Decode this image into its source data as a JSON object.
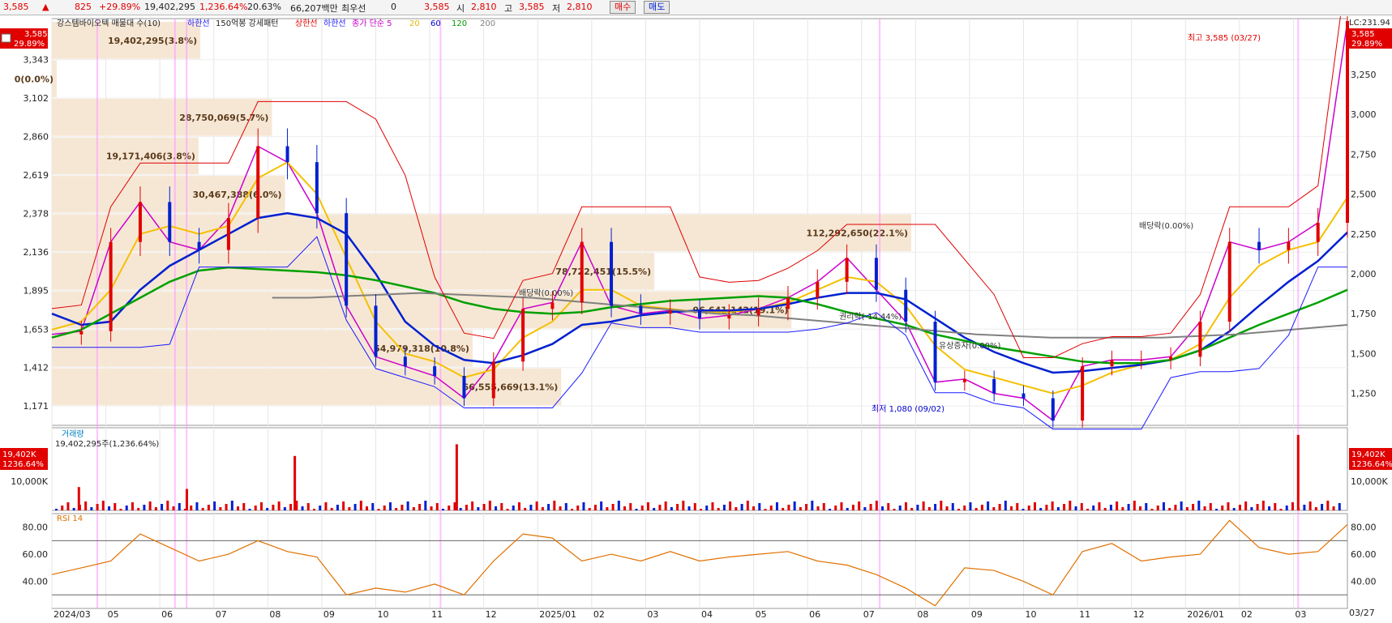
{
  "topbar": {
    "price": "3,585",
    "price_arrow": "▲",
    "change": "825",
    "change_pct": "+29.89%",
    "volume": "19,402,295",
    "volume_ratio": "1,236.64%",
    "turnover": "20.63%",
    "amount": "66,207백만",
    "pref_label": "최우선",
    "pref_value": "0",
    "pref_price": "3,585",
    "open_label": "시",
    "open_value": "2,810",
    "high_label": "고",
    "high_value": "3,585",
    "low_label": "저",
    "low_value": "2,810",
    "buy_button": "매수",
    "sell_button": "매도"
  },
  "legend": {
    "items": [
      {
        "text": "강스템바이오텍 매물대 수(10)",
        "color": "#222222"
      },
      {
        "text": "하한선",
        "color": "#1a1aff"
      },
      {
        "text": "150억봉 강세패턴",
        "color": "#222222"
      },
      {
        "text": "상한선",
        "color": "#e00000"
      },
      {
        "text": "하한선",
        "color": "#1a1aff"
      },
      {
        "text": "종가 단순 5",
        "color": "#cc00cc"
      },
      {
        "text": "20",
        "color": "#e6b800"
      },
      {
        "text": "60",
        "color": "#0000cc"
      },
      {
        "text": "120",
        "color": "#009900"
      },
      {
        "text": "200",
        "color": "#808080"
      }
    ]
  },
  "price_axis": {
    "left_ticks": [
      "3,343",
      "3,102",
      "2,860",
      "2,619",
      "2,378",
      "2,136",
      "1,895",
      "1,653",
      "1,412",
      "1,171"
    ],
    "right_ticks": [
      "3,250",
      "3,000",
      "2,750",
      "2,500",
      "2,250",
      "2,000",
      "1,750",
      "1,500",
      "1,250"
    ],
    "current_left": "3,585",
    "current_left_pct": "29.89%",
    "current_right": "3,585",
    "current_right_pct": "29.89%",
    "lc_label": "LC:231.94"
  },
  "annotations": {
    "high": "최고 3,585 (03/27)",
    "low": "최저 1,080 (09/02)",
    "dividend1": "배당락(0.00%)",
    "rights": "권리락(-14.44%)",
    "paidin": "유상증자(0.00%)",
    "dividend2": "배당락(0.00%)"
  },
  "volume_panel": {
    "title": "거래량",
    "summary": "19,402,295주(1,236.64%)",
    "tick": "10,000K",
    "tick_right": "10,000K",
    "current_left": "19,402K",
    "current_left_pct": "1236.64%",
    "current_right": "19,402K",
    "current_right_pct": "1236.64%"
  },
  "rsi_panel": {
    "title": "RSI 14",
    "ticks": [
      "80.00",
      "60.00",
      "40.00"
    ],
    "ticks_right": [
      "80.00",
      "60.00",
      "40.00"
    ]
  },
  "x_axis": {
    "labels": [
      "2024/03",
      "05",
      "06",
      "07",
      "08",
      "09",
      "10",
      "11",
      "12",
      "2025/01",
      "02",
      "03",
      "04",
      "05",
      "06",
      "07",
      "08",
      "09",
      "10",
      "11",
      "12",
      "2026/01",
      "02",
      "03"
    ],
    "right_label": "03/27"
  },
  "chart_data": {
    "type": "line",
    "title": "강스템바이오텍",
    "xlabel": "",
    "ylabel": "",
    "ylim": [
      1050,
      3600
    ],
    "x_range": [
      "2024/03",
      "2026/03/27"
    ],
    "series": [
      {
        "name": "종가",
        "values": [
          1620,
          1640,
          2200,
          2450,
          2200,
          2150,
          2350,
          2800,
          2700,
          2380,
          1800,
          1480,
          1420,
          1360,
          1220,
          1450,
          1780,
          1820,
          2200,
          1800,
          1750,
          1770,
          1720,
          1740,
          1780,
          1850,
          1950,
          2100,
          1900,
          1700,
          1320,
          1340,
          1250,
          1220,
          1080,
          1420,
          1460,
          1460,
          1480,
          1700,
          2200,
          2150,
          2200,
          2320,
          3585
        ]
      },
      {
        "name": "20",
        "values": [
          1650,
          1700,
          1900,
          2250,
          2300,
          2250,
          2300,
          2600,
          2700,
          2500,
          2100,
          1700,
          1500,
          1450,
          1350,
          1400,
          1600,
          1700,
          1900,
          1900,
          1800,
          1780,
          1760,
          1760,
          1780,
          1820,
          1900,
          1980,
          1950,
          1800,
          1550,
          1400,
          1350,
          1300,
          1250,
          1300,
          1380,
          1430,
          1460,
          1560,
          1850,
          2050,
          2150,
          2200,
          2480
        ]
      },
      {
        "name": "60",
        "values": [
          1750,
          1680,
          1700,
          1900,
          2050,
          2150,
          2250,
          2350,
          2380,
          2350,
          2250,
          2000,
          1700,
          1550,
          1460,
          1440,
          1490,
          1560,
          1680,
          1700,
          1740,
          1760,
          1770,
          1770,
          1780,
          1810,
          1850,
          1880,
          1880,
          1840,
          1720,
          1600,
          1510,
          1440,
          1380,
          1390,
          1410,
          1430,
          1460,
          1520,
          1640,
          1800,
          1950,
          2080,
          2260
        ]
      },
      {
        "name": "120",
        "values": [
          1600,
          1650,
          1750,
          1850,
          1950,
          2020,
          2040,
          2030,
          2020,
          2010,
          1990,
          1960,
          1920,
          1880,
          1820,
          1780,
          1760,
          1750,
          1760,
          1790,
          1810,
          1830,
          1840,
          1850,
          1860,
          1850,
          1810,
          1760,
          1720,
          1680,
          1620,
          1580,
          1540,
          1510,
          1480,
          1450,
          1440,
          1440,
          1460,
          1520,
          1600,
          1680,
          1750,
          1820,
          1900
        ]
      },
      {
        "name": "200",
        "values": [
          1850,
          1850,
          1860,
          1870,
          1880,
          1870,
          1860,
          1850,
          1830,
          1810,
          1790,
          1770,
          1750,
          1740,
          1720,
          1700,
          1680,
          1660,
          1640,
          1620,
          1610,
          1600,
          1600,
          1600,
          1600,
          1610,
          1620,
          1640,
          1660,
          1680
        ]
      }
    ],
    "volume_profile": [
      {
        "price_low": 3343,
        "price_high": 3585,
        "volume": 19402295,
        "label": "19,402,295(3.8%)"
      },
      {
        "price_low": 3102,
        "price_high": 3343,
        "volume": 0,
        "label": "0(0.0%)"
      },
      {
        "price_low": 2860,
        "price_high": 3102,
        "volume": 28750069,
        "label": "28,750,069(5.7%)"
      },
      {
        "price_low": 2619,
        "price_high": 2860,
        "volume": 19171406,
        "label": "19,171,406(3.8%)"
      },
      {
        "price_low": 2378,
        "price_high": 2619,
        "volume": 30467388,
        "label": "30,467,388(6.0%)"
      },
      {
        "price_low": 2136,
        "price_high": 2378,
        "volume": 112292650,
        "label": "112,292,650(22.1%)"
      },
      {
        "price_low": 1895,
        "price_high": 2136,
        "volume": 78722451,
        "label": "78,722,451(15.5%)"
      },
      {
        "price_low": 1653,
        "price_high": 1895,
        "volume": 96641142,
        "label": "96,641,142(19.1%)"
      },
      {
        "price_low": 1412,
        "price_high": 1653,
        "volume": 54979318,
        "label": "54,979,318(10.8%)"
      },
      {
        "price_low": 1171,
        "price_high": 1412,
        "volume": 66555669,
        "label": "66,555,669(13.1%)"
      }
    ],
    "rsi_ylim": [
      20,
      90
    ],
    "rsi_values": [
      45,
      50,
      55,
      75,
      65,
      55,
      60,
      70,
      62,
      58,
      30,
      35,
      32,
      38,
      30,
      55,
      75,
      72,
      55,
      60,
      55,
      62,
      55,
      58,
      60,
      62,
      55,
      52,
      45,
      35,
      22,
      50,
      48,
      40,
      30,
      62,
      68,
      55,
      58,
      60,
      85,
      65,
      60,
      62,
      82
    ],
    "volume_spikes": [
      {
        "x": "2024/03",
        "value": 6000
      },
      {
        "x": "2024/06",
        "value": 5500
      },
      {
        "x": "2024/11",
        "value": 17000
      },
      {
        "x": "2025/08",
        "value": 14000
      },
      {
        "x": "2026/03/27",
        "value": 19402
      }
    ]
  }
}
